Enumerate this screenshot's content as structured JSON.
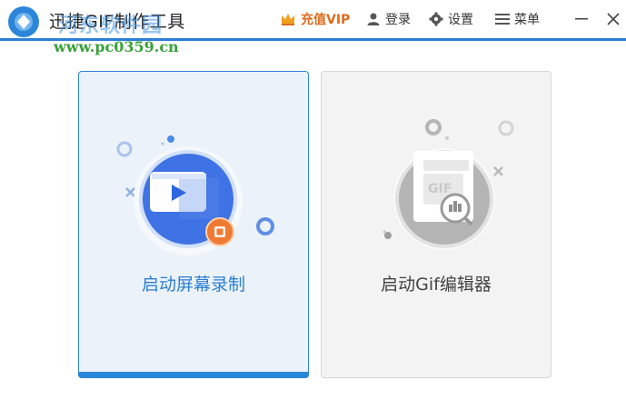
{
  "app": {
    "title": "迅捷GIF制作工具",
    "watermark_title": "河东软件园",
    "watermark_url": "www.pc0359.cn"
  },
  "toolbar": {
    "vip_label": "充值VIP",
    "login_label": "登录",
    "settings_label": "设置",
    "menu_label": "菜单"
  },
  "cards": {
    "record": {
      "label": "启动屏幕录制"
    },
    "gif_editor": {
      "label": "启动Gif编辑器",
      "illustration_text": "GIF"
    }
  },
  "colors": {
    "accent": "#2b86d9",
    "vip": "#e06a1b",
    "record_card_bg": "#ecf2f9",
    "gif_card_bg": "#f3f3f3"
  }
}
